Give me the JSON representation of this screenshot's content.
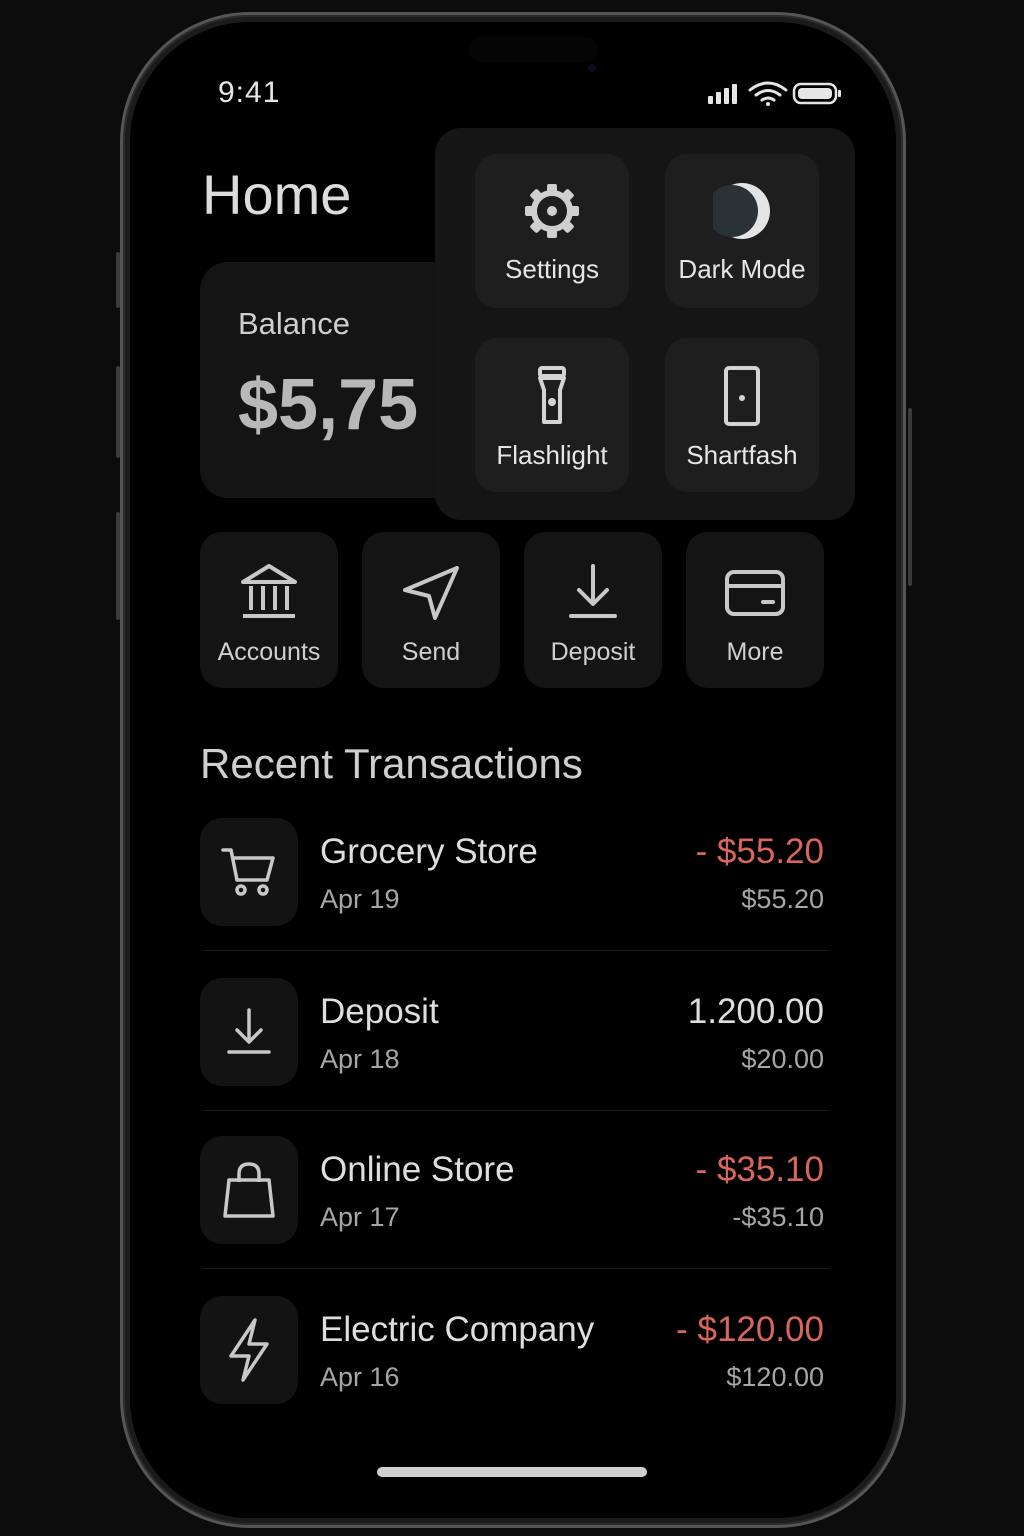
{
  "status_bar": {
    "time": "9:41"
  },
  "header": {
    "title": "Home"
  },
  "balance": {
    "label": "Balance",
    "amount": "$5,75"
  },
  "quick_settings": {
    "tiles": [
      {
        "label": "Settings",
        "icon": "gear-icon"
      },
      {
        "label": "Dark Mode",
        "icon": "moon-icon"
      },
      {
        "label": "Flashlight",
        "icon": "flashlight-icon"
      },
      {
        "label": "Shartfash",
        "icon": "door-icon"
      }
    ]
  },
  "actions": [
    {
      "label": "Accounts",
      "icon": "bank-icon"
    },
    {
      "label": "Send",
      "icon": "send-icon"
    },
    {
      "label": "Deposit",
      "icon": "download-icon"
    },
    {
      "label": "More",
      "icon": "card-icon"
    }
  ],
  "transactions": {
    "title": "Recent Transactions",
    "items": [
      {
        "name": "Grocery Store",
        "date": "Apr 19",
        "amount": "- $55.20",
        "sub": "$55.20",
        "icon": "cart-icon",
        "negative": true
      },
      {
        "name": "Deposit",
        "date": "Apr 18",
        "amount": "1.200.00",
        "sub": "$20.00",
        "icon": "download-icon",
        "negative": false
      },
      {
        "name": "Online Store",
        "date": "Apr 17",
        "amount": "- $35.10",
        "sub": "-$35.10",
        "icon": "bag-icon",
        "negative": true
      },
      {
        "name": "Electric Company",
        "date": "Apr 16",
        "amount": "- $120.00",
        "sub": "$120.00",
        "icon": "bolt-icon",
        "negative": true
      }
    ]
  },
  "colors": {
    "negative": "#d9665c",
    "positive": "#dedede",
    "background": "#000000"
  }
}
